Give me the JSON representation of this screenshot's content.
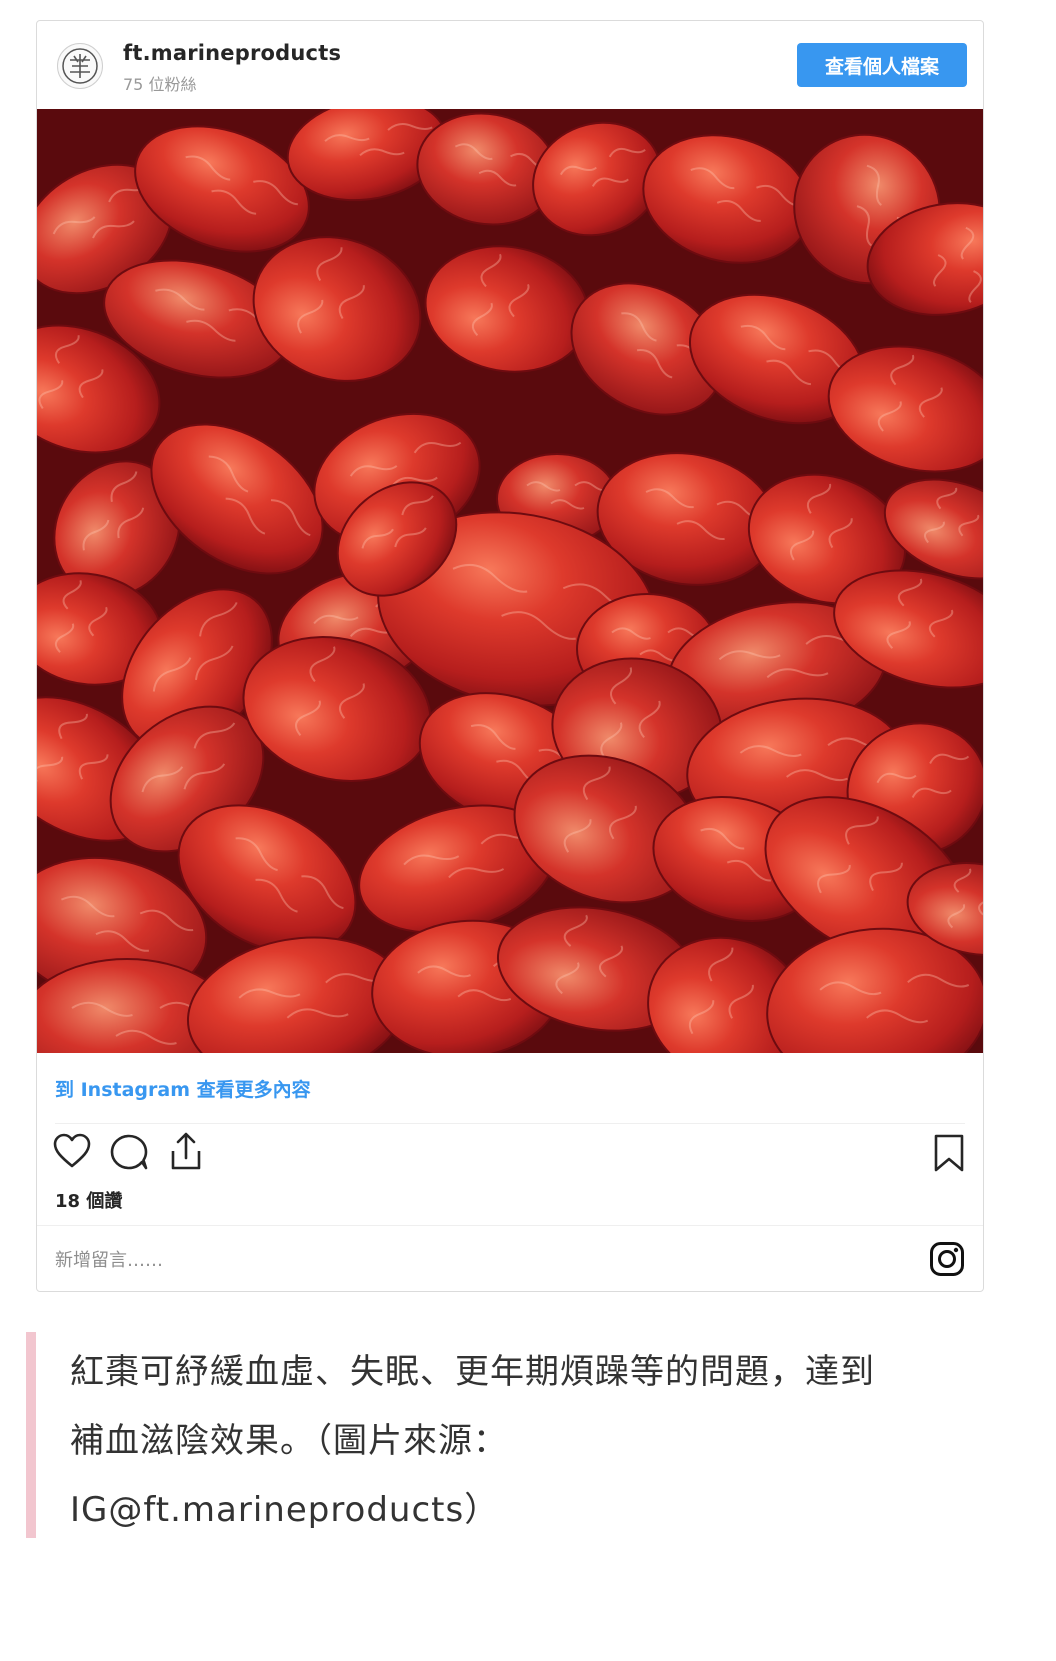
{
  "embed": {
    "username": "ft.marineproducts",
    "followers": "75 位粉絲",
    "view_profile_label": "查看個人檔案",
    "photo_alt": "紅棗",
    "more_link": "到 Instagram 查看更多內容",
    "likes": "18 個讚",
    "comment_placeholder": "新增留言……",
    "icons": [
      "heart-icon",
      "comment-icon",
      "share-icon",
      "bookmark-icon",
      "instagram-logo-icon"
    ],
    "accent_color": "#3897f0"
  },
  "caption": {
    "line1": "紅棗可紓緩血虛、失眠、更年期煩躁等的問題，達到",
    "line2": "補血滋陰效果。（圖片來源：",
    "line3": "IG@ft.marineproducts）",
    "bar_color": "#f2c6cf"
  }
}
